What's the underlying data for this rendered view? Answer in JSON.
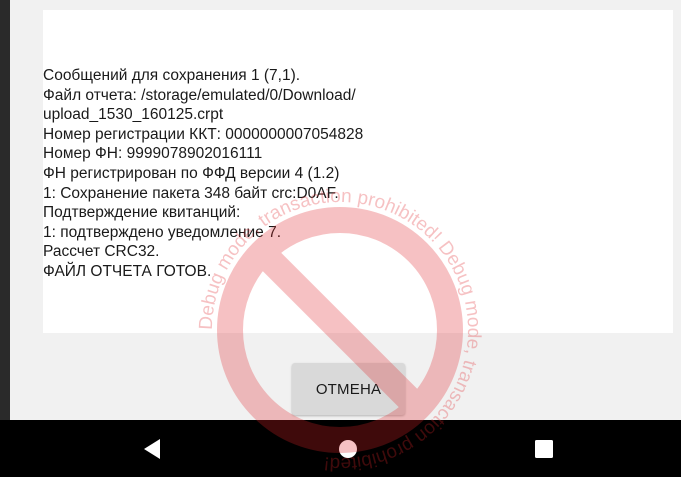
{
  "dialog": {
    "log_lines": [
      "Сообщений для сохранения 1 (7,1).",
      "Файл отчета: /storage/emulated/0/Download/",
      "upload_1530_160125.crpt",
      "Номер регистрации ККТ: 0000000007054828",
      "Номер ФН: 9999078902016111",
      "ФН регистрирован по ФФД версии 4 (1.2)",
      "1: Сохранение пакета 348 байт crc:D0AF.",
      "Подтверждение квитанций:",
      "1: подтверждено уведомление 7.",
      "Рассчет CRC32.",
      "ФАЙЛ ОТЧЕТА ГОТОВ."
    ],
    "cancel_label": "ОТМЕНА"
  },
  "watermark": {
    "text": "Debug mode, transaction prohibited! Debug mode, transaction prohibited!",
    "color": "#e0262a"
  },
  "navbar": {
    "back_icon": "back-triangle-icon",
    "home_icon": "home-circle-icon",
    "recents_icon": "recents-square-icon"
  }
}
